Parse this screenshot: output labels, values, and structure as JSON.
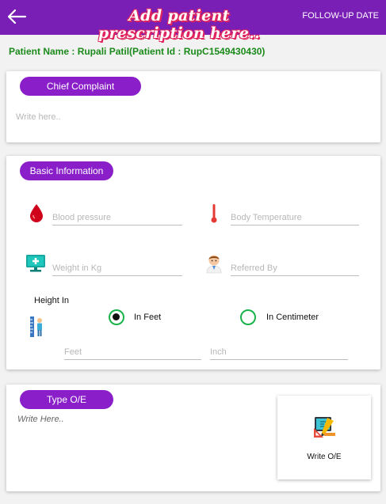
{
  "header": {
    "title": "Add patient prescription here..",
    "followup_label": "FOLLOW-UP DATE",
    "back_icon": "arrow-left-icon"
  },
  "patient": {
    "line": "Patient Name : Rupali Patil(Patient Id : RupC1549430430)"
  },
  "chief_complaint": {
    "heading": "Chief Complaint",
    "placeholder": "Write here.."
  },
  "basic_info": {
    "heading": "Basic Information",
    "blood_pressure_placeholder": "Blood pressure",
    "body_temperature_placeholder": "Body Temperature",
    "weight_placeholder": "Weight in Kg",
    "referred_by_placeholder": "Referred By",
    "height_label": "Height In",
    "option_feet": "In Feet",
    "option_cm": "In Centimeter",
    "selected_option": "In Feet",
    "feet_placeholder": "Feet",
    "inch_placeholder": "Inch",
    "icons": [
      "blood-drop-icon",
      "thermometer-icon",
      "monitor-health-icon",
      "doctor-avatar-icon",
      "height-ruler-icon"
    ]
  },
  "oe": {
    "heading": "Type O/E",
    "placeholder": "Write Here..",
    "button_label": "Write O/E",
    "button_icon": "tablet-pencil-ruler-icon"
  },
  "colors": {
    "header_bg": "#7a1fb5",
    "pill_bg": "#8a1fc9",
    "patient_text": "#1a8a1a",
    "radio": "#19b34a"
  }
}
